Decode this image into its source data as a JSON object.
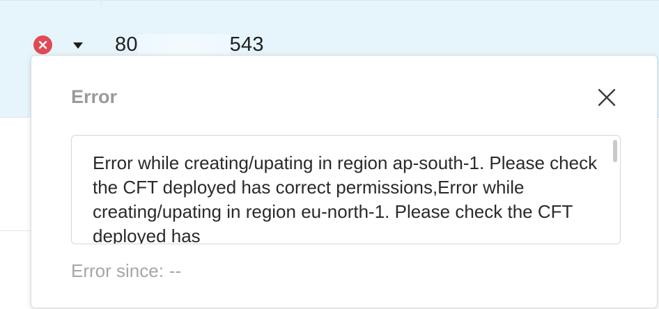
{
  "row": {
    "status_icon": "error-x-icon",
    "expand_icon": "caret-down-icon",
    "account_id_prefix": "80",
    "account_id_suffix": "543"
  },
  "popover": {
    "title": "Error",
    "close_icon": "close-icon",
    "message": "Error while creating/upating in region ap-south-1. Please check the CFT deployed has correct permissions,Error while creating/upating in region eu-north-1. Please check the CFT deployed has",
    "error_since_label": "Error since:",
    "error_since_value": "--"
  },
  "colors": {
    "row_highlight": "#e6f4fb",
    "error_red": "#e04a55",
    "title_gray": "#9a9a9a",
    "muted_gray": "#a6a6a6"
  }
}
